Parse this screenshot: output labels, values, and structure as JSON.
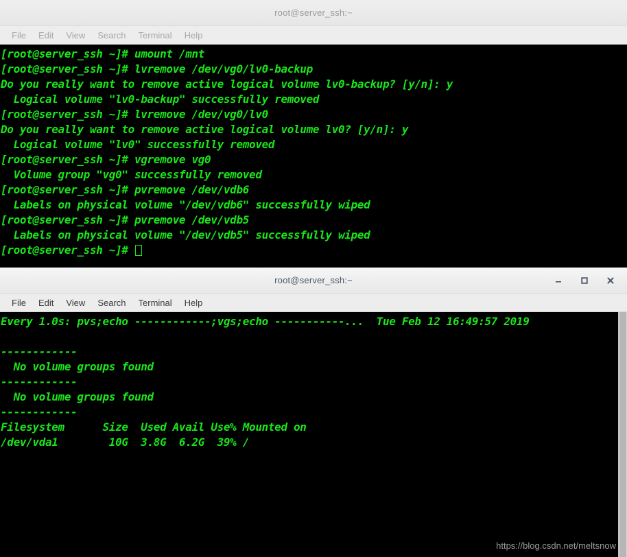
{
  "colors": {
    "terminal_bg": "#000000",
    "terminal_fg": "#19e619",
    "titlebar_bg": "#efefef",
    "title_text_active": "#4a5662",
    "title_text_inactive": "#9a9a9a",
    "menu_text_active": "#3b3b3b",
    "menu_text_inactive": "#a8a8a8",
    "scrollbar": "#b6b6b6",
    "watermark": "#9d9d9d"
  },
  "window_top": {
    "title": "root@server_ssh:~",
    "focused": false,
    "menu": [
      {
        "label": "File",
        "name": "menu-file"
      },
      {
        "label": "Edit",
        "name": "menu-edit"
      },
      {
        "label": "View",
        "name": "menu-view"
      },
      {
        "label": "Search",
        "name": "menu-search"
      },
      {
        "label": "Terminal",
        "name": "menu-terminal"
      },
      {
        "label": "Help",
        "name": "menu-help"
      }
    ],
    "lines": [
      "[root@server_ssh ~]# umount /mnt",
      "[root@server_ssh ~]# lvremove /dev/vg0/lv0-backup",
      "Do you really want to remove active logical volume lv0-backup? [y/n]: y",
      "  Logical volume \"lv0-backup\" successfully removed",
      "[root@server_ssh ~]# lvremove /dev/vg0/lv0",
      "Do you really want to remove active logical volume lv0? [y/n]: y",
      "  Logical volume \"lv0\" successfully removed",
      "[root@server_ssh ~]# vgremove vg0",
      "  Volume group \"vg0\" successfully removed",
      "[root@server_ssh ~]# pvremove /dev/vdb6",
      "  Labels on physical volume \"/dev/vdb6\" successfully wiped",
      "[root@server_ssh ~]# pvremove /dev/vdb5",
      "  Labels on physical volume \"/dev/vdb5\" successfully wiped"
    ],
    "prompt_line": "[root@server_ssh ~]# "
  },
  "window_bottom": {
    "title": "root@server_ssh:~",
    "focused": true,
    "buttons": {
      "minimize": "minimize",
      "maximize": "maximize",
      "close": "close"
    },
    "menu": [
      {
        "label": "File",
        "name": "menu-file"
      },
      {
        "label": "Edit",
        "name": "menu-edit"
      },
      {
        "label": "View",
        "name": "menu-view"
      },
      {
        "label": "Search",
        "name": "menu-search"
      },
      {
        "label": "Terminal",
        "name": "menu-terminal"
      },
      {
        "label": "Help",
        "name": "menu-help"
      }
    ],
    "watch_header": "Every 1.0s: pvs;echo ------------;vgs;echo -----------...  Tue Feb 12 16:49:57 2019",
    "lines": [
      "",
      "------------",
      "  No volume groups found",
      "------------",
      "  No volume groups found",
      "------------",
      "Filesystem      Size  Used Avail Use% Mounted on",
      "/dev/vda1        10G  3.8G  6.2G  39% /"
    ]
  },
  "watermark": {
    "text": "https://blog.csdn.net/meltsnow"
  }
}
